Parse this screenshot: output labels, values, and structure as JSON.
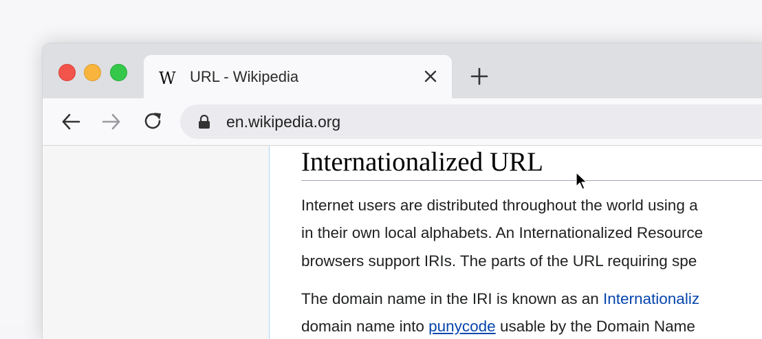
{
  "browser": {
    "tab": {
      "favicon": "W",
      "title": "URL - Wikipedia"
    },
    "address_bar": {
      "url": "en.wikipedia.org"
    }
  },
  "article": {
    "heading": "Internationalized URL",
    "lines": [
      "Internet users are distributed throughout the world using a",
      "in their own local alphabets. An Internationalized Resource",
      "browsers support IRIs. The parts of the URL requiring spe"
    ],
    "para2": {
      "line1_prefix": "The domain name in the IRI is known as an ",
      "line1_link": "Internationaliz",
      "line2_prefix": "domain name into ",
      "line2_link": "punycode",
      "line2_suffix": " usable by the Domain Name"
    }
  },
  "colors": {
    "link": "#0645ad",
    "traffic_red": "#f2544c",
    "traffic_yellow": "#f8b43d",
    "traffic_green": "#35c84a"
  },
  "icons": [
    "close-window-icon",
    "minimize-window-icon",
    "zoom-window-icon",
    "wikipedia-favicon",
    "close-tab-icon",
    "plus-icon",
    "back-arrow-icon",
    "forward-arrow-icon",
    "reload-icon",
    "lock-icon",
    "mouse-cursor-icon"
  ]
}
